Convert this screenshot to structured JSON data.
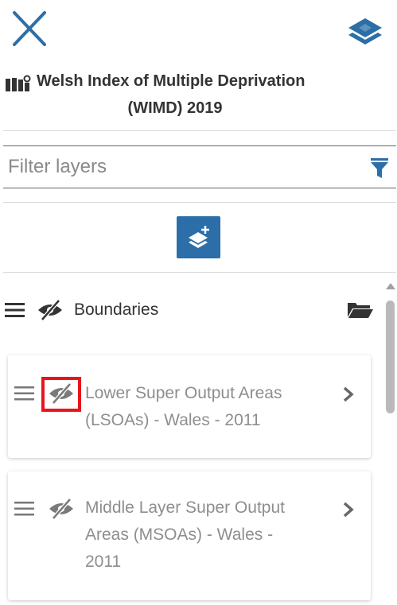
{
  "header": {
    "close_icon": "close-icon",
    "layers_icon": "layers-icon",
    "title_line1": "Welsh Index of Multiple Deprivation",
    "title_line2": "(WIMD) 2019",
    "title_icon": "map-icon"
  },
  "filter": {
    "placeholder": "Filter layers",
    "value": "",
    "icon": "filter-icon"
  },
  "add_layer_button": {
    "icon": "add-layer-icon"
  },
  "group": {
    "label": "Boundaries",
    "visible": false,
    "icon": "folder-open-icon"
  },
  "layers": [
    {
      "line1": "Lower Super Output Areas",
      "line2": "(LSOAs) - Wales - 2011",
      "visible": false,
      "highlighted": true
    },
    {
      "line1": "Middle Layer Super Output",
      "line2": "Areas (MSOAs) - Wales -",
      "line3": "2011",
      "visible": false,
      "highlighted": false
    }
  ],
  "colors": {
    "accent": "#2b6ea8",
    "highlight": "#e8141c",
    "text": "#333333",
    "muted_text": "#8e8e8e"
  }
}
